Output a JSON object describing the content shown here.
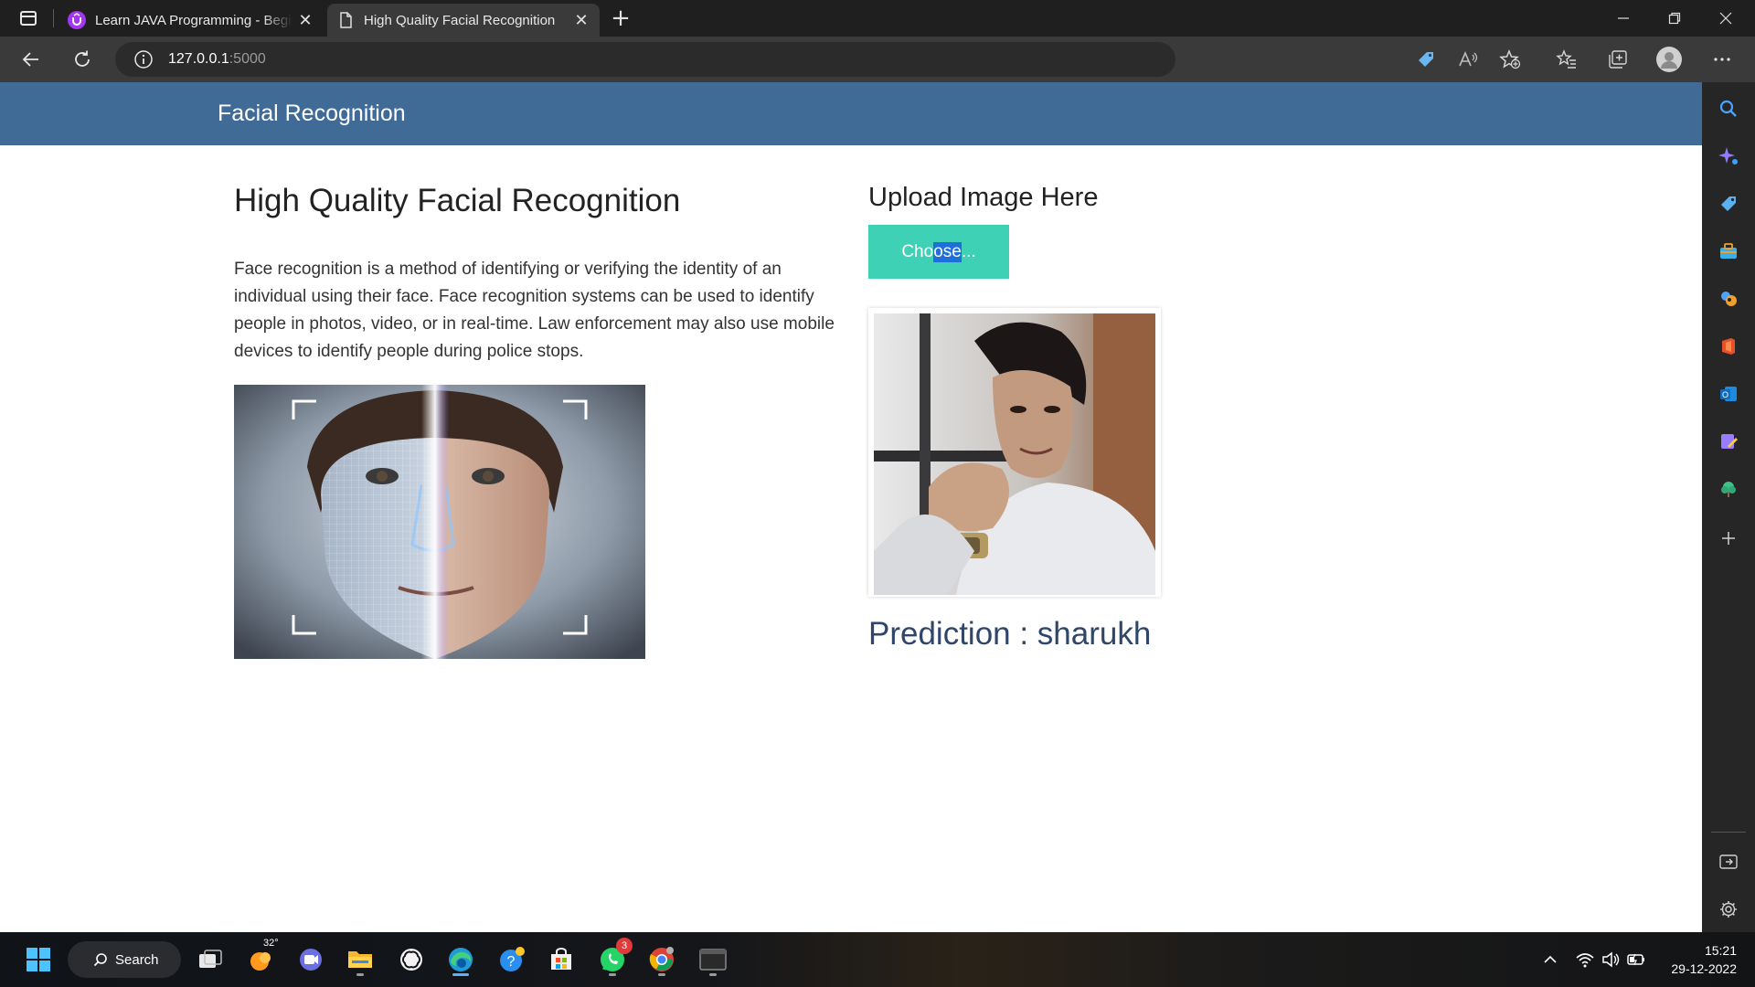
{
  "browser": {
    "tabs": [
      {
        "title": "Learn JAVA Programming - Begin",
        "favicon": "udemy-icon",
        "active": false
      },
      {
        "title": "High Quality Facial Recognition",
        "favicon": "page-icon",
        "active": true
      }
    ],
    "url_host": "127.0.0.1",
    "url_port": ":5000",
    "profile_icon": "profile-avatar-icon"
  },
  "site": {
    "brand": "Facial Recognition",
    "header_color": "#416b97"
  },
  "main": {
    "title": "High Quality Facial Recognition",
    "description": "Face recognition is a method of identifying or verifying the identity of an individual using their face. Face recognition systems can be used to identify people in photos, video, or in real-time. Law enforcement may also use mobile devices to identify people during police stops."
  },
  "upload": {
    "title": "Upload Image Here",
    "button_label_start": "Cho",
    "button_label_selected": "ose",
    "button_label_end": "...",
    "button_color": "#3fd1b5",
    "prediction_label": "Prediction : sharukh"
  },
  "taskbar": {
    "search_label": "Search",
    "weather_temp": "32°",
    "whatsapp_badge": "3",
    "time": "15:21",
    "date": "29-12-2022"
  }
}
